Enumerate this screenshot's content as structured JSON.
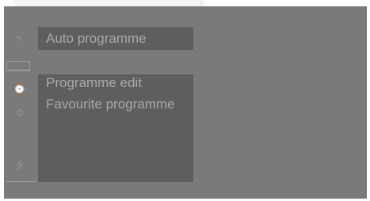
{
  "menu": {
    "top_item": "Auto programme",
    "submenu_items": [
      "Programme edit",
      "Favourite programme"
    ]
  },
  "icons": [
    {
      "name": "antenna-icon",
      "glyph": "↖"
    },
    {
      "name": "picture-icon",
      "glyph": "▭"
    },
    {
      "name": "timer-icon",
      "glyph": "⌚"
    },
    {
      "name": "setup-icon",
      "glyph": "⚙"
    },
    {
      "name": "usb-icon",
      "glyph": "⭍"
    }
  ],
  "colors": {
    "panel": "#7a7a7a",
    "menu_bg": "#5e5e5e",
    "text": "#a9a9a9"
  }
}
